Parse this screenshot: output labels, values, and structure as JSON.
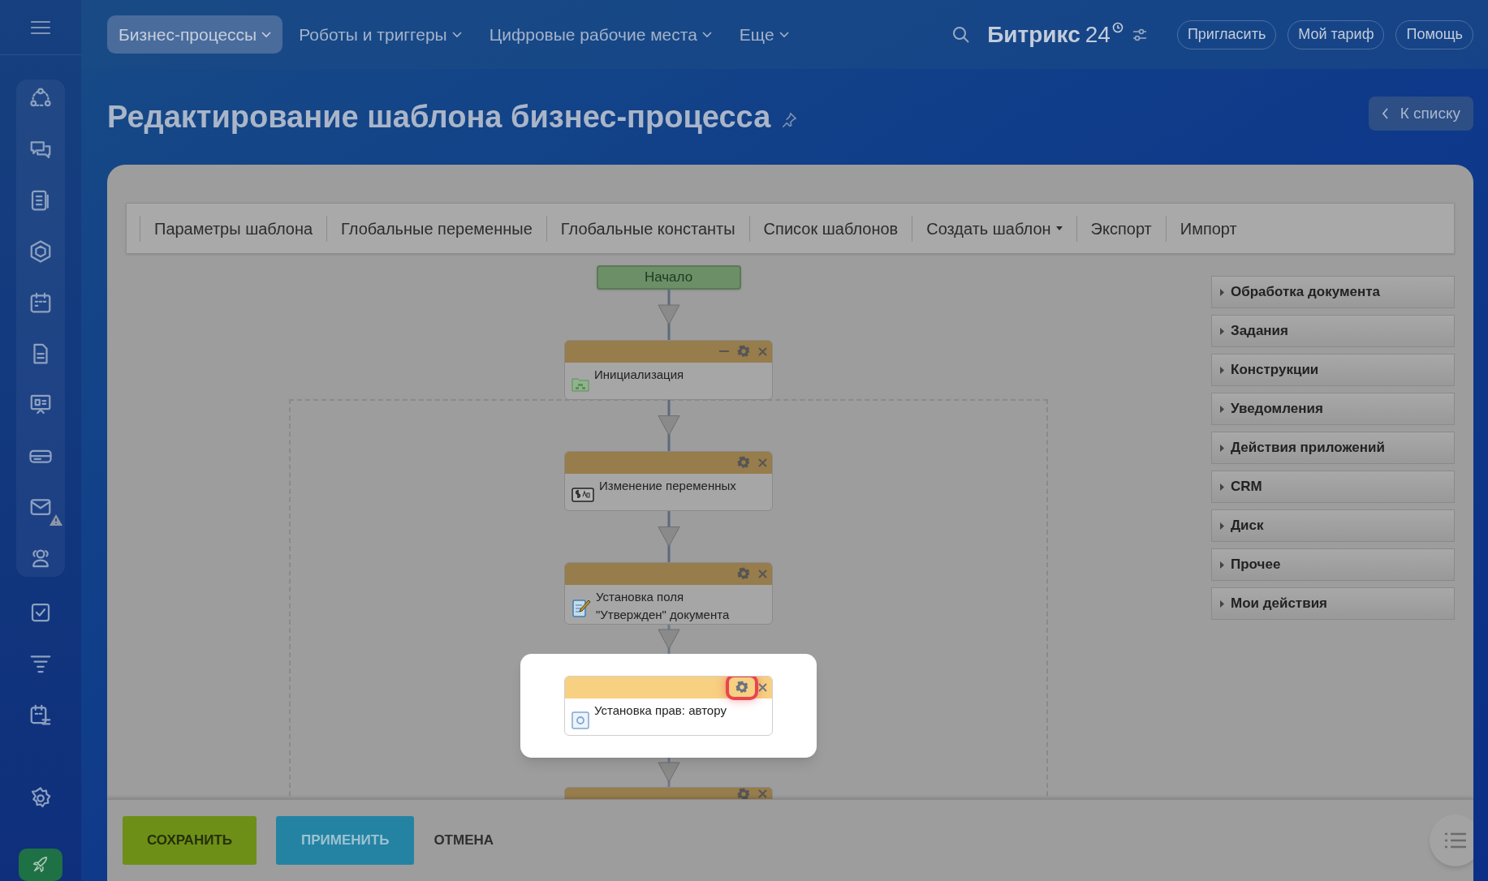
{
  "top_nav": {
    "items": [
      {
        "label": "Бизнес-процессы",
        "selected": true
      },
      {
        "label": "Роботы и триггеры",
        "selected": false
      },
      {
        "label": "Цифровые рабочие места",
        "selected": false
      },
      {
        "label": "Еще",
        "selected": false
      }
    ],
    "brand": "Битрикс",
    "brand_number": "24",
    "buttons": [
      "Пригласить",
      "Мой тариф",
      "Помощь"
    ]
  },
  "sidebar": {
    "items": [
      {
        "alert": false
      },
      {
        "alert": false
      },
      {
        "alert": false
      },
      {
        "alert": false
      },
      {
        "alert": false
      },
      {
        "alert": false
      },
      {
        "alert": false
      },
      {
        "alert": false
      },
      {
        "alert": true
      },
      {
        "alert": false
      },
      {
        "alert": false
      },
      {
        "alert": false
      },
      {
        "alert": false
      },
      {
        "alert": false
      }
    ]
  },
  "page_title": "Редактирование шаблона бизнес-процесса",
  "back_button": "К списку",
  "toolbar": [
    {
      "label": "Параметры шаблона",
      "dropdown": false
    },
    {
      "label": "Глобальные переменные",
      "dropdown": false
    },
    {
      "label": "Глобальные константы",
      "dropdown": false
    },
    {
      "label": "Список шаблонов",
      "dropdown": false
    },
    {
      "label": "Создать шаблон",
      "dropdown": true
    },
    {
      "label": "Экспорт",
      "dropdown": false
    },
    {
      "label": "Импорт",
      "dropdown": false
    }
  ],
  "start_node": "Начало",
  "blocks": [
    {
      "title": "Инициализация",
      "minimizable": true,
      "highlighted": false
    },
    {
      "title": "Изменение переменных",
      "minimizable": false,
      "highlighted": false
    },
    {
      "title": "Установка поля \"Утвержден\" документа",
      "minimizable": false,
      "highlighted": false
    },
    {
      "title": "Установка прав: автору",
      "minimizable": false,
      "highlighted": true
    }
  ],
  "activity_groups": [
    "Обработка документа",
    "Задания",
    "Конструкции",
    "Уведомления",
    "Действия приложений",
    "CRM",
    "Диск",
    "Прочее",
    "Мои действия"
  ],
  "footer": {
    "save": "СОХРАНИТЬ",
    "apply": "ПРИМЕНИТЬ",
    "cancel": "ОТМЕНА"
  }
}
